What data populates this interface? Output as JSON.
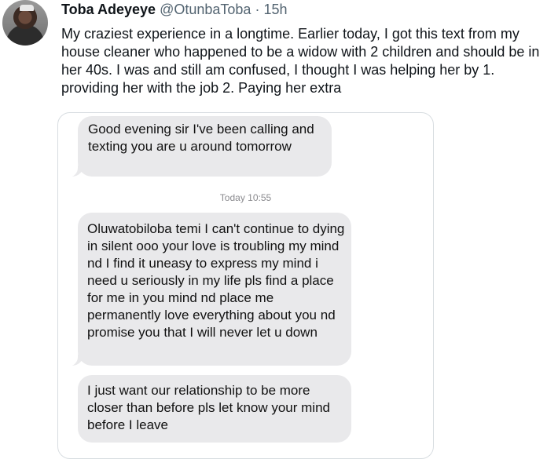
{
  "tweet": {
    "author_name": "Toba Adeyeye",
    "handle": "@OtunbaToba",
    "separator": "·",
    "time": "15h",
    "text": "My craziest experience in a longtime. Earlier today, I got this text from my house cleaner who happened to be a widow with 2 children and should be in her 40s. I was and still am confused, I thought I was helping her by 1. providing her with the job 2. Paying her extra"
  },
  "screenshot": {
    "messages": [
      {
        "text": "Good evening sir I've been calling and texting you are u around tomorrow"
      },
      {
        "text": "Oluwatobiloba temi I can't continue to dying in silent ooo your love is troubling my mind nd I find it uneasy to express my mind i need u seriously in my life pls find a place for me in you mind nd place me permanently love everything about you nd promise you that I will never let u down"
      },
      {
        "text": "I just want our relationship to be more closer than before pls let know your mind before I leave"
      }
    ],
    "timestamp": "Today 10:55"
  },
  "colors": {
    "bubble": "#e9e9eb",
    "secondary_text": "#536471",
    "card_border": "#d8dde1"
  }
}
